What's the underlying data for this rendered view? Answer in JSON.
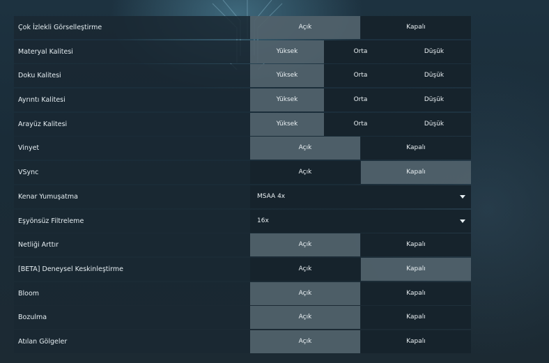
{
  "settings": [
    {
      "label": "Çok İzlekli Görselleştirme",
      "type": "toggle",
      "options": [
        "Açık",
        "Kapalı"
      ],
      "selected": 0
    },
    {
      "label": "Materyal Kalitesi",
      "type": "triple",
      "options": [
        "Yüksek",
        "Orta",
        "Düşük"
      ],
      "selected": 0
    },
    {
      "label": "Doku Kalitesi",
      "type": "triple",
      "options": [
        "Yüksek",
        "Orta",
        "Düşük"
      ],
      "selected": 0
    },
    {
      "label": "Ayrıntı Kalitesi",
      "type": "triple",
      "options": [
        "Yüksek",
        "Orta",
        "Düşük"
      ],
      "selected": 0
    },
    {
      "label": "Arayüz Kalitesi",
      "type": "triple",
      "options": [
        "Yüksek",
        "Orta",
        "Düşük"
      ],
      "selected": 0
    },
    {
      "label": "Vinyet",
      "type": "toggle",
      "options": [
        "Açık",
        "Kapalı"
      ],
      "selected": 0
    },
    {
      "label": "VSync",
      "type": "toggle",
      "options": [
        "Açık",
        "Kapalı"
      ],
      "selected": 1
    },
    {
      "label": "Kenar Yumuşatma",
      "type": "dropdown",
      "value": "MSAA 4x"
    },
    {
      "label": "Eşyönsüz Filtreleme",
      "type": "dropdown",
      "value": "16x"
    },
    {
      "label": "Netliği Arttır",
      "type": "toggle",
      "options": [
        "Açık",
        "Kapalı"
      ],
      "selected": 0
    },
    {
      "label": "[BETA] Deneysel Keskinleştirme",
      "type": "toggle",
      "options": [
        "Açık",
        "Kapalı"
      ],
      "selected": 1
    },
    {
      "label": "Bloom",
      "type": "toggle",
      "options": [
        "Açık",
        "Kapalı"
      ],
      "selected": 0
    },
    {
      "label": "Bozulma",
      "type": "toggle",
      "options": [
        "Açık",
        "Kapalı"
      ],
      "selected": 0
    },
    {
      "label": "Atılan Gölgeler",
      "type": "toggle",
      "options": [
        "Açık",
        "Kapalı"
      ],
      "selected": 0
    }
  ],
  "icons": {
    "dropdown_caret": "caret-down-icon"
  },
  "colors": {
    "selected_option": "#788a94",
    "unselected_option": "#16222b",
    "row_background": "#1a2832"
  }
}
